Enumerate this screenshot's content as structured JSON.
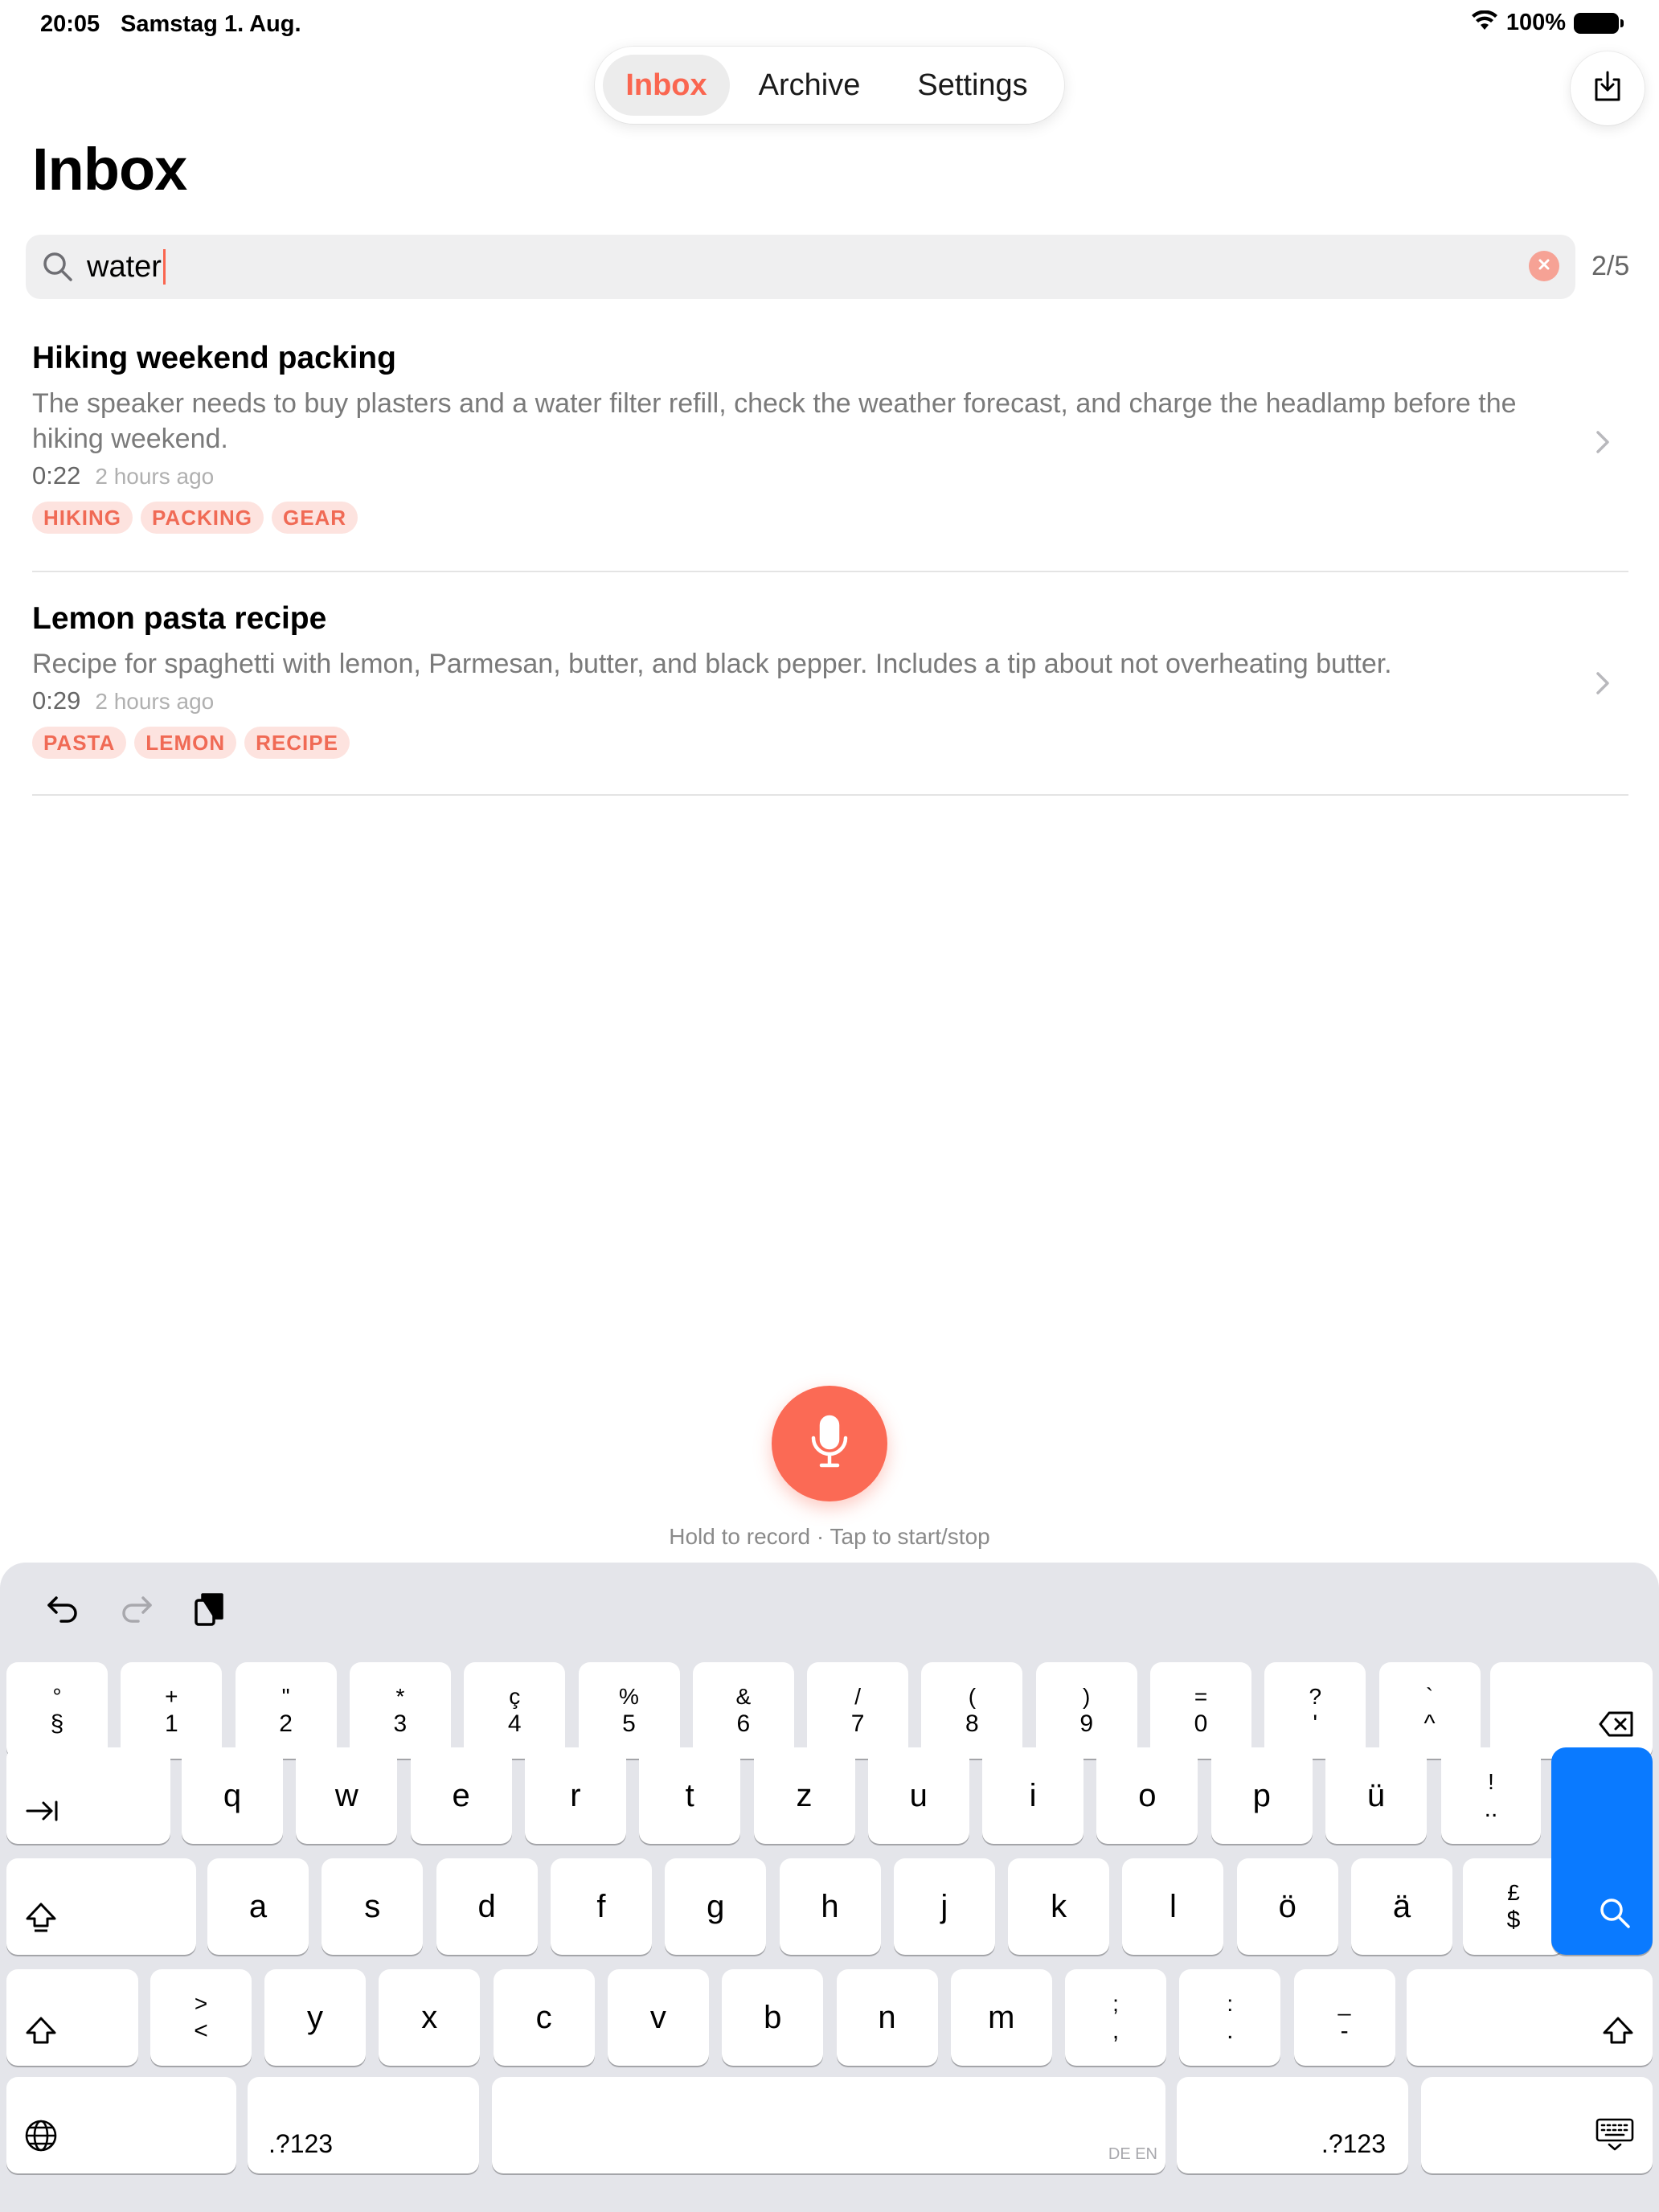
{
  "status_bar": {
    "time": "20:05",
    "date": "Samstag 1. Aug.",
    "battery": "100%"
  },
  "nav": {
    "tabs": [
      "Inbox",
      "Archive",
      "Settings"
    ],
    "active": "Inbox"
  },
  "page": {
    "title": "Inbox"
  },
  "search": {
    "value": "water",
    "match_count": "2/5"
  },
  "notes": [
    {
      "title": "Hiking weekend packing",
      "summary": "The speaker needs to buy plasters and a water filter refill, check the weather forecast, and charge the headlamp before the hiking weekend.",
      "duration": "0:22",
      "time_ago": "2 hours ago",
      "tags": [
        "HIKING",
        "PACKING",
        "GEAR"
      ]
    },
    {
      "title": "Lemon pasta recipe",
      "summary": "Recipe for spaghetti with lemon, Parmesan, butter, and black pepper. Includes a tip about not overheating butter.",
      "duration": "0:29",
      "time_ago": "2 hours ago",
      "tags": [
        "PASTA",
        "LEMON",
        "RECIPE"
      ]
    }
  ],
  "record": {
    "hint": "Hold to record · Tap to start/stop"
  },
  "keyboard": {
    "number_row": [
      {
        "top": "°",
        "bottom": "§"
      },
      {
        "top": "+",
        "bottom": "1"
      },
      {
        "top": "\"",
        "bottom": "2"
      },
      {
        "top": "*",
        "bottom": "3"
      },
      {
        "top": "ç",
        "bottom": "4"
      },
      {
        "top": "%",
        "bottom": "5"
      },
      {
        "top": "&",
        "bottom": "6"
      },
      {
        "top": "/",
        "bottom": "7"
      },
      {
        "top": "(",
        "bottom": "8"
      },
      {
        "top": ")",
        "bottom": "9"
      },
      {
        "top": "=",
        "bottom": "0"
      },
      {
        "top": "?",
        "bottom": "'"
      },
      {
        "top": "`",
        "bottom": "^"
      }
    ],
    "row1": [
      "q",
      "w",
      "e",
      "r",
      "t",
      "z",
      "u",
      "i",
      "o",
      "p",
      "ü"
    ],
    "row1_extra": {
      "top": "!",
      "bottom": ".."
    },
    "row2": [
      "a",
      "s",
      "d",
      "f",
      "g",
      "h",
      "j",
      "k",
      "l",
      "ö",
      "ä"
    ],
    "row2_extra": {
      "top": "£",
      "bottom": "$"
    },
    "row3_first": {
      "top": ">",
      "bottom": "<"
    },
    "row3": [
      "y",
      "x",
      "c",
      "v",
      "b",
      "n",
      "m"
    ],
    "row3_punct": [
      {
        "top": ";",
        "bottom": ","
      },
      {
        "top": ":",
        "bottom": "."
      },
      {
        "top": "_",
        "bottom": "-"
      }
    ],
    "numbers_label": ".?123",
    "space_hint": "DE EN"
  },
  "colors": {
    "accent": "#fa6650",
    "search_key": "#0a7aff",
    "tag_bg": "#fde3df"
  },
  "icons": {
    "export": "tray-arrow-down-icon",
    "search": "magnifier-icon",
    "clear": "x-circle-icon",
    "chevron": "chevron-right-icon",
    "mic": "microphone-icon",
    "undo": "undo-icon",
    "redo": "redo-icon",
    "paste": "clipboard-icon",
    "delete": "delete-left-icon",
    "tab": "tab-arrow-icon",
    "shift": "shift-arrow-icon",
    "globe": "globe-icon",
    "hide_keyboard": "keyboard-hide-icon"
  }
}
